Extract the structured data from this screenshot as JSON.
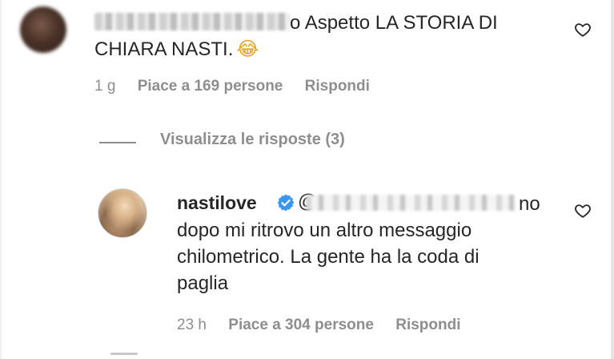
{
  "comment_1": {
    "text_line1": "o Aspetto LA STORIA DI",
    "text_line2": "CHIARA NASTI.",
    "emoji": "😂",
    "time": "1 g",
    "likes": "Piace a 169 persone",
    "reply": "Rispondi"
  },
  "view_replies": "Visualizza le risposte (3)",
  "comment_2": {
    "username": "nastilove",
    "mention_start": "@",
    "text_line1": "no",
    "text_line2": "dopo mi ritrovo un altro messaggio",
    "text_line3": "chilometrico. La gente ha la coda di",
    "text_line4": "paglia",
    "time": "23 h",
    "likes": "Piace a 304 persone",
    "reply": "Rispondi"
  },
  "icons": {
    "like": "heart-outline-icon",
    "verified": "verified-badge-icon"
  },
  "colors": {
    "text": "#262626",
    "secondary": "#8e8e8e",
    "verified": "#3897f0"
  }
}
